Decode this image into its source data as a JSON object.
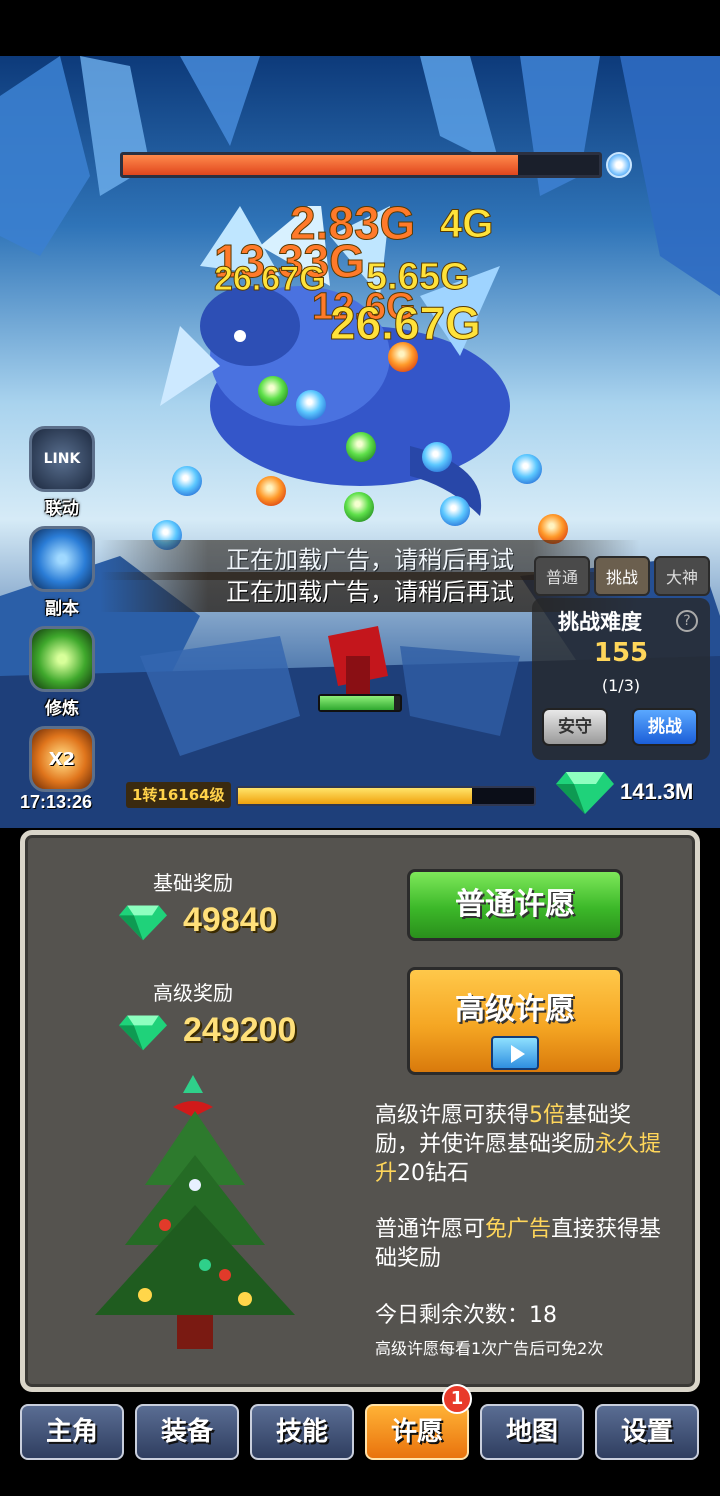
{
  "boss": {
    "hp_fraction": 0.83
  },
  "damage_numbers": [
    "2.83G",
    "4G",
    "13.33G",
    "26.67G",
    "5.65G",
    "12.6G",
    "26.67G"
  ],
  "side_buttons": [
    {
      "label": "联动",
      "icon": "linkage-icon",
      "icon_text": "LINK"
    },
    {
      "label": "副本",
      "icon": "portal-icon"
    },
    {
      "label": "修炼",
      "icon": "cultivation-icon"
    },
    {
      "label": "",
      "icon": "double-reward-icon",
      "icon_text": "X2"
    }
  ],
  "timer": "17:13:26",
  "toasts": [
    "正在加载广告，请稍后再试",
    "正在加载广告，请稍后再试"
  ],
  "mode_tabs": [
    "普通",
    "挑战",
    "大神"
  ],
  "difficulty": {
    "title": "挑战难度",
    "help": "?",
    "level": "155",
    "progress": "(1/3)",
    "safe_label": "安守",
    "challenge_label": "挑战"
  },
  "level": {
    "tag": "1转16164级",
    "progress_fraction": 0.79
  },
  "gems_total": "141.3M",
  "wish": {
    "base_label": "基础奖励",
    "base_value": "49840",
    "premium_label": "高级奖励",
    "premium_value": "249200",
    "normal_button": "普通许愿",
    "premium_button": "高级许愿",
    "desc1_a": "高级许愿可获得",
    "desc1_hl": "5倍",
    "desc1_b": "基础奖励，并使许愿基础奖励",
    "desc1_hl2": "永久提升",
    "desc1_c": "20钻石",
    "desc2_a": "普通许愿可",
    "desc2_hl": "免广告",
    "desc2_b": "直接获得基础奖励",
    "remaining": "今日剩余次数：18",
    "note": "高级许愿每看1次广告后可免2次"
  },
  "nav": {
    "items": [
      "主角",
      "装备",
      "技能",
      "许愿",
      "地图",
      "设置"
    ],
    "active": "许愿",
    "badge": "1"
  },
  "colors": {
    "accent_orange": "#f5a623",
    "accent_green": "#3cb829",
    "gold_text": "#ffd65a"
  }
}
